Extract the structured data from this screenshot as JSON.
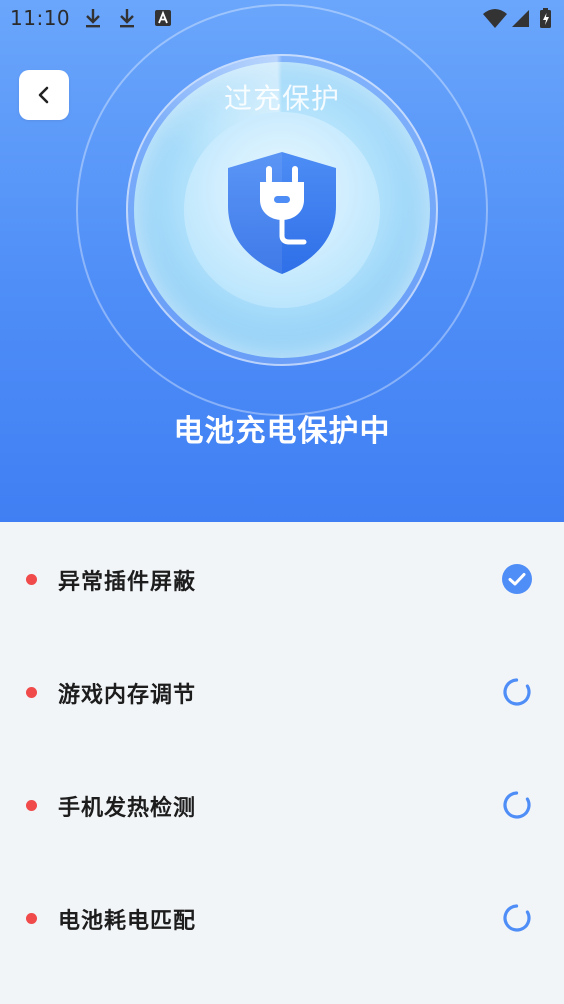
{
  "status_bar": {
    "time": "11:10",
    "icons": [
      "download-icon",
      "download-icon",
      "font-app-icon",
      "wifi-icon",
      "signal-icon",
      "battery-charging-icon"
    ]
  },
  "header": {
    "back_icon": "chevron-left-icon",
    "top_text": "过充保护",
    "status_title": "电池充电保护中",
    "center_icon": "shield-plug-icon"
  },
  "items": [
    {
      "label": "异常插件屏蔽",
      "state": "done"
    },
    {
      "label": "游戏内存调节",
      "state": "loading"
    },
    {
      "label": "手机发热检测",
      "state": "loading"
    },
    {
      "label": "电池耗电匹配",
      "state": "loading"
    }
  ],
  "colors": {
    "accent": "#4f8ef7",
    "bullet": "#f04a4a",
    "list_bg": "#f2f5f8"
  }
}
